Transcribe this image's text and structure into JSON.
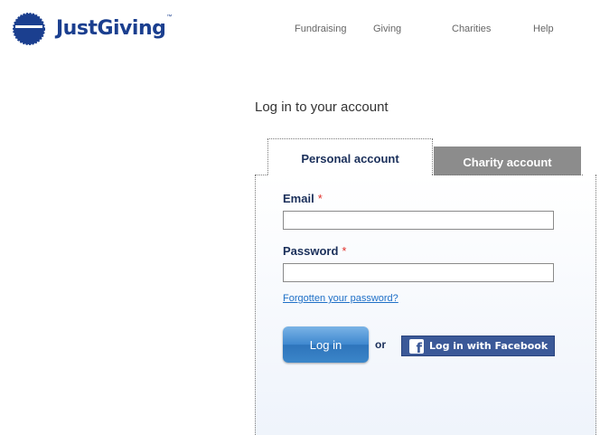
{
  "brand": {
    "name": "JustGiving",
    "trademark": "™",
    "color": "#1b3f8f"
  },
  "nav": {
    "items": [
      {
        "label": "Fundraising"
      },
      {
        "label": "Giving"
      },
      {
        "label": "Charities"
      },
      {
        "label": "Help"
      }
    ]
  },
  "login": {
    "title": "Log in to your account",
    "tabs": [
      {
        "label": "Personal account",
        "active": true
      },
      {
        "label": "Charity account",
        "active": false
      }
    ],
    "email_label": "Email",
    "password_label": "Password",
    "required_mark": "*",
    "email_value": "",
    "password_value": "",
    "forgot_link": "Forgotten your password?",
    "login_button": "Log in",
    "or_text": "or",
    "facebook_button": "Log in with Facebook",
    "facebook_icon": "f"
  },
  "colors": {
    "accent": "#1f70c7",
    "facebook": "#3b5998",
    "inactive_tab": "#8c8c8c",
    "required": "#e0302a"
  }
}
